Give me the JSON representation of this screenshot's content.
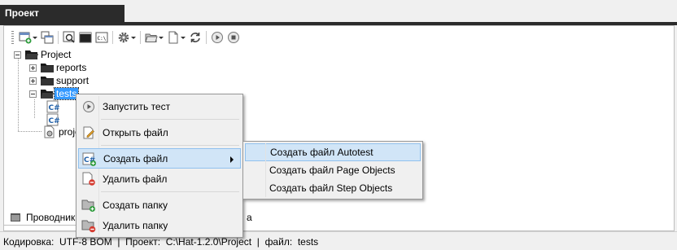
{
  "panel": {
    "title": "Проект"
  },
  "toolbar": {
    "buttons": [
      {
        "name": "new-item-icon",
        "dropdown": true
      },
      {
        "name": "windows-icon",
        "dropdown": false
      },
      {
        "name": "preview-icon",
        "dropdown": false
      },
      {
        "name": "console-icon",
        "dropdown": false
      },
      {
        "name": "terminal-icon",
        "dropdown": false
      },
      {
        "name": "settings-gear-icon",
        "dropdown": true
      },
      {
        "name": "open-folder-icon",
        "dropdown": true
      },
      {
        "name": "new-file-icon",
        "dropdown": true
      },
      {
        "name": "refresh-icon",
        "dropdown": false
      },
      {
        "name": "run-icon",
        "dropdown": false
      },
      {
        "name": "stop-icon",
        "dropdown": false
      }
    ]
  },
  "tree": {
    "root": "Project",
    "items": [
      {
        "label": "reports",
        "expanded": false
      },
      {
        "label": "support",
        "expanded": false
      },
      {
        "label": "tests",
        "expanded": true,
        "selected": true
      }
    ],
    "project_file": "proje"
  },
  "context_menu": {
    "items": [
      {
        "label": "Запустить тест",
        "icon": "run-icon"
      },
      {
        "label": "Открыть файл",
        "icon": "edit-file-icon"
      },
      {
        "label": "Создать файл",
        "icon": "csharp-file-add-icon",
        "highlighted": true,
        "submenu": true
      },
      {
        "label": "Удалить файл",
        "icon": "file-delete-icon"
      },
      {
        "label": "Создать папку",
        "icon": "folder-add-icon"
      },
      {
        "label": "Удалить папку",
        "icon": "folder-delete-icon"
      }
    ]
  },
  "submenu": {
    "items": [
      {
        "label": "Создать файл Autotest",
        "highlighted": true
      },
      {
        "label": "Создать файл Page Objects"
      },
      {
        "label": "Создать файл Step Objects"
      }
    ]
  },
  "bottom_tabs": {
    "explorer": "Проводник",
    "third_partial": "a"
  },
  "status": {
    "encoding_label": "Кодировка:",
    "encoding": "UTF-8 BOM",
    "sep": "|",
    "project_label": "Проект:",
    "project_path": "C:\\Hat-1.2.0\\Project",
    "file_label": "файл:",
    "file": "tests"
  },
  "colors": {
    "title_bar": "#2b2b2b",
    "selection": "#3399ff",
    "menu_highlight": "#d1e5f7",
    "menu_highlight_border": "#90c1ee"
  }
}
